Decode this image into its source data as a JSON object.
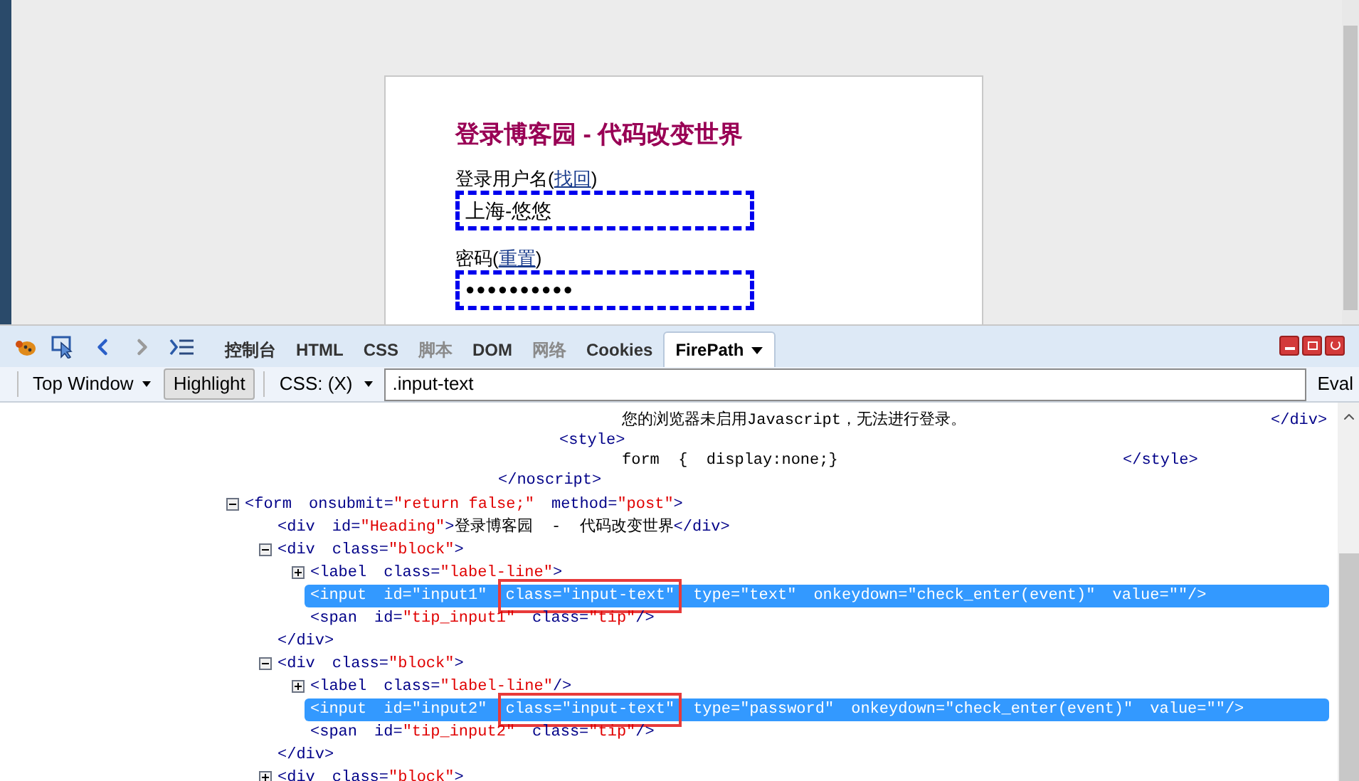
{
  "page": {
    "heading": "登录博客园 - 代码改变世界",
    "username": {
      "label": "登录用户名(",
      "link": "找回",
      "label_end": ")",
      "value": "上海-悠悠",
      "focused": true
    },
    "password": {
      "label": "密码(",
      "link": "重置",
      "label_end": ")",
      "value": "●●●●●●●●●●",
      "focused": true
    }
  },
  "devtools": {
    "tabs": [
      {
        "label": "控制台",
        "selected": false,
        "disabled": false
      },
      {
        "label": "HTML",
        "selected": false,
        "disabled": false
      },
      {
        "label": "CSS",
        "selected": false,
        "disabled": false
      },
      {
        "label": "脚本",
        "selected": false,
        "disabled": true
      },
      {
        "label": "DOM",
        "selected": false,
        "disabled": false
      },
      {
        "label": "网络",
        "selected": false,
        "disabled": true
      },
      {
        "label": "Cookies",
        "selected": false,
        "disabled": false
      },
      {
        "label": "FirePath",
        "selected": true,
        "disabled": false
      }
    ],
    "toolbar": {
      "frame": "Top Window",
      "highlight": {
        "label": "Highlight",
        "on": true
      },
      "mode": "CSS: (X)",
      "query": ".input-text",
      "eval": "Eval"
    },
    "noscript_lines": [
      {
        "kind": "text",
        "text": "您的浏览器未启用Javascript，无法进行登录。",
        "end": "</div>"
      },
      {
        "kind": "open",
        "text": "<style>"
      },
      {
        "kind": "text",
        "text": "form  {  display:none;}",
        "end": "</style>"
      },
      {
        "kind": "close",
        "text": "</noscript>"
      }
    ],
    "tree": [
      {
        "expanded": true,
        "selected": false,
        "tag": "<form",
        "attrs": [
          {
            "name": "onsubmit=",
            "value": "\"return false;\"",
            "boxed": false
          },
          {
            "name": "method=",
            "value": "\"post\"",
            "boxed": false
          }
        ],
        "close": ">",
        "children": [
          {
            "selected": false,
            "tag": "<div",
            "attrs": [
              {
                "name": "id=",
                "value": "\"Heading\"",
                "boxed": false
              }
            ],
            "close": ">",
            "text": "登录博客园  -  代码改变世界",
            "end": "</div>"
          },
          {
            "expanded": true,
            "selected": false,
            "tag": "<div",
            "attrs": [
              {
                "name": "class=",
                "value": "\"block\"",
                "boxed": false
              }
            ],
            "close": ">",
            "end_line": "</div>",
            "children": [
              {
                "expanded": false,
                "selected": false,
                "tag": "<label",
                "attrs": [
                  {
                    "name": "class=",
                    "value": "\"label-line\"",
                    "boxed": false
                  }
                ],
                "close": ">"
              },
              {
                "selected": true,
                "tag": "<input",
                "attrs": [
                  {
                    "name": "id=",
                    "value": "\"input1\"",
                    "boxed": false
                  },
                  {
                    "name": "class=",
                    "value": "\"input-text\"",
                    "boxed": true
                  },
                  {
                    "name": "type=",
                    "value": "\"text\"",
                    "boxed": false
                  },
                  {
                    "name": "onkeydown=",
                    "value": "\"check_enter(event)\"",
                    "boxed": false
                  },
                  {
                    "name": "value=",
                    "value": "\"\"",
                    "boxed": false
                  }
                ],
                "close": "/>"
              },
              {
                "selected": false,
                "tag": "<span",
                "attrs": [
                  {
                    "name": "id=",
                    "value": "\"tip_input1\"",
                    "boxed": false
                  },
                  {
                    "name": "class=",
                    "value": "\"tip\"",
                    "boxed": false
                  }
                ],
                "close": "/>"
              }
            ]
          },
          {
            "expanded": true,
            "selected": false,
            "tag": "<div",
            "attrs": [
              {
                "name": "class=",
                "value": "\"block\"",
                "boxed": false
              }
            ],
            "close": ">",
            "end_line": "</div>",
            "children": [
              {
                "expanded": false,
                "selected": false,
                "tag": "<label",
                "attrs": [
                  {
                    "name": "class=",
                    "value": "\"label-line\"",
                    "boxed": false
                  }
                ],
                "close": "/>"
              },
              {
                "selected": true,
                "tag": "<input",
                "attrs": [
                  {
                    "name": "id=",
                    "value": "\"input2\"",
                    "boxed": false
                  },
                  {
                    "name": "class=",
                    "value": "\"input-text\"",
                    "boxed": true
                  },
                  {
                    "name": "type=",
                    "value": "\"password\"",
                    "boxed": false
                  },
                  {
                    "name": "onkeydown=",
                    "value": "\"check_enter(event)\"",
                    "boxed": false
                  },
                  {
                    "name": "value=",
                    "value": "\"\"",
                    "boxed": false
                  }
                ],
                "close": "/>"
              },
              {
                "selected": false,
                "tag": "<span",
                "attrs": [
                  {
                    "name": "id=",
                    "value": "\"tip_input2\"",
                    "boxed": false
                  },
                  {
                    "name": "class=",
                    "value": "\"tip\"",
                    "boxed": false
                  }
                ],
                "close": "/>"
              }
            ]
          },
          {
            "expanded": false,
            "selected": false,
            "tag": "<div",
            "attrs": [
              {
                "name": "class=",
                "value": "\"block\"",
                "boxed": false
              }
            ],
            "close": ">"
          }
        ]
      }
    ]
  }
}
